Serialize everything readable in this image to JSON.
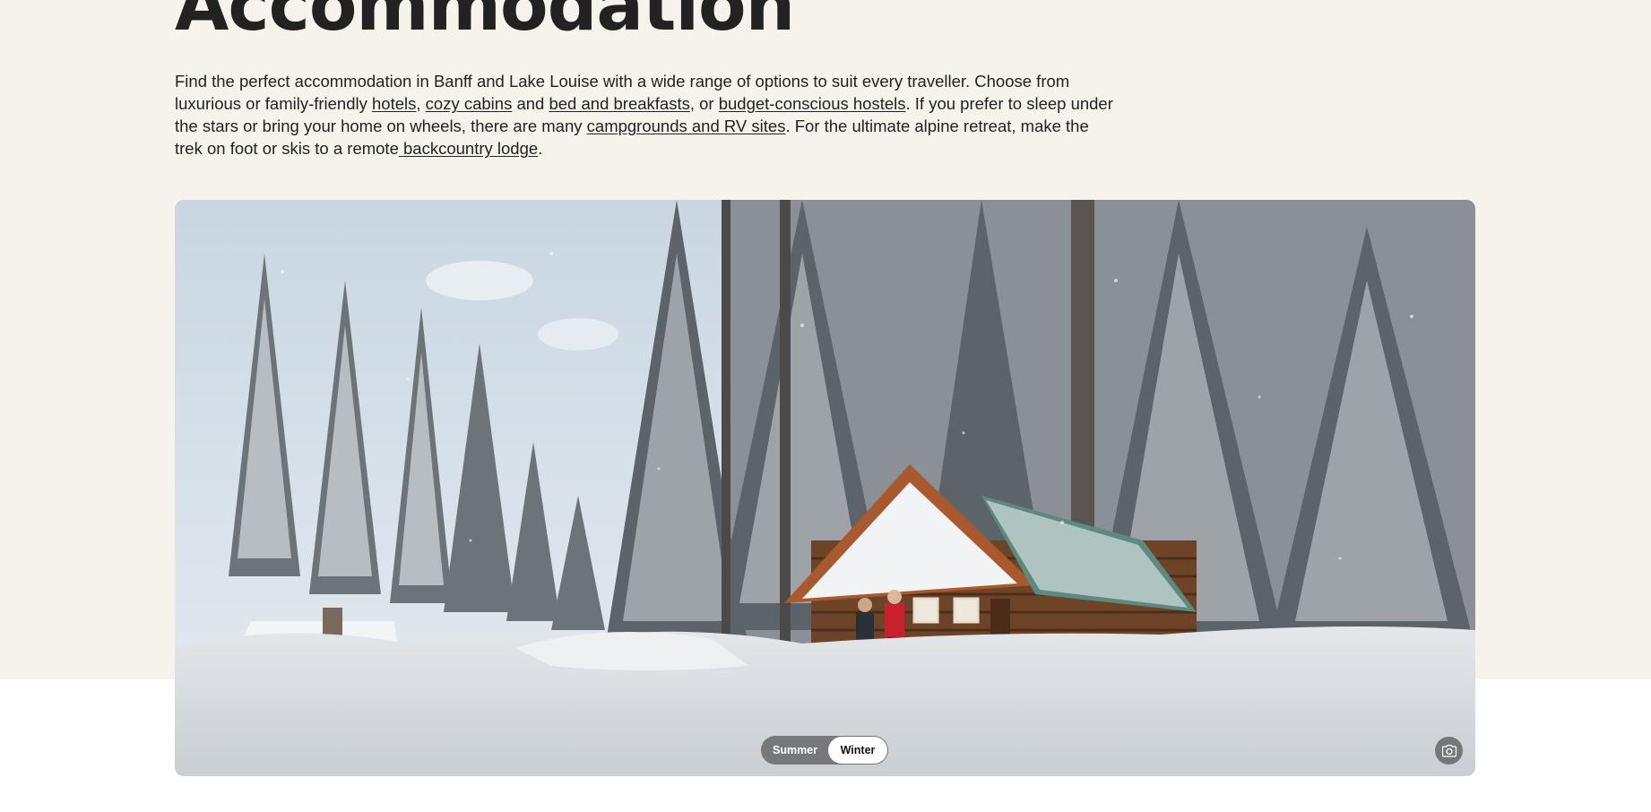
{
  "page": {
    "title": "Accommodation",
    "intro": {
      "part1": "Find the perfect accommodation in Banff and Lake Louise with a wide range of options to suit every traveller. Choose from luxurious or family-friendly ",
      "link_hotels": "hotels",
      "sep1": ", ",
      "link_cabins": "cozy cabins",
      "sep2": " and ",
      "link_bnb": "bed and breakfasts",
      "sep3": ", or ",
      "link_hostels": "budget-conscious hostels",
      "part2": ". If you prefer to sleep under the stars or bring your home on wheels, there are many ",
      "link_campgrounds": "campgrounds and RV sites",
      "part3": ". For the ultimate alpine retreat, make the trek on foot or skis to a remote",
      "link_backcountry": " backcountry lodge",
      "part4": "."
    }
  },
  "hero": {
    "image_alt": "Snow-covered log cabin among tall snowy spruce trees with two people on the porch",
    "season_toggle": {
      "options": [
        "Summer",
        "Winter"
      ],
      "selected": "Winter"
    },
    "camera_icon": "camera-icon"
  },
  "colors": {
    "background": "#f5f3ec",
    "text": "#222222",
    "toggle_active_bg": "#ffffff",
    "toggle_bg": "#5a5a5a"
  }
}
